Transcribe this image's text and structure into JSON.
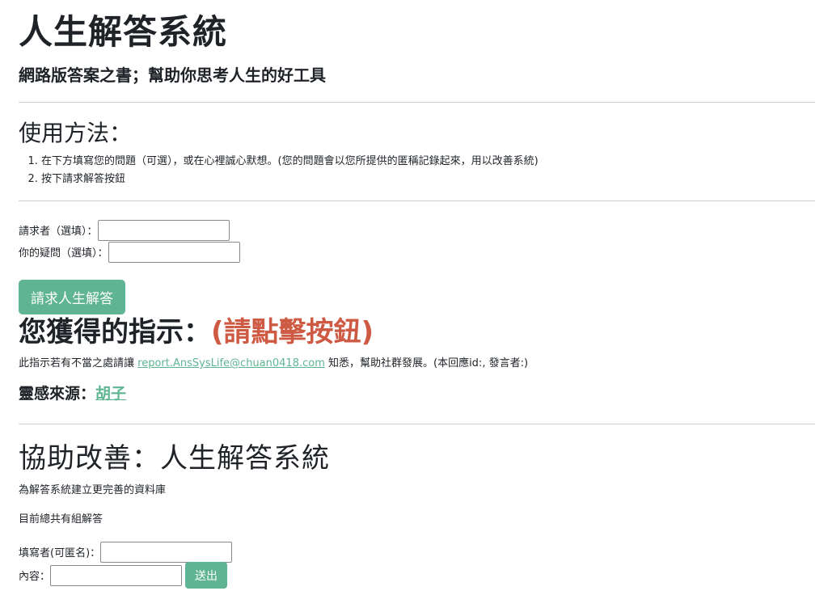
{
  "header": {
    "title": "人生解答系統",
    "subtitle": "網路版答案之書；幫助你思考人生的好工具"
  },
  "usage": {
    "title": "使用方法：",
    "steps": [
      "在下方填寫您的問題（可選），或在心裡誠心默想。(您的問題會以您所提供的匿稱記錄起來，用以改善系統)",
      "按下請求解答按鈕"
    ]
  },
  "request_form": {
    "requester_label": "請求者（選填）：",
    "requester_value": "",
    "question_label": "你的疑問（選填）：",
    "question_value": "",
    "button_label": "請求人生解答"
  },
  "answer": {
    "heading": "您獲得的指示：",
    "text": "(請點擊按鈕)",
    "report_prefix": "此指示若有不當之處請讓",
    "report_email": "report.AnsSysLife@chuan0418.com",
    "report_suffix": "知悉，幫助社群發展。(本回應id:, 發言者:)",
    "source_label": "靈感來源：",
    "source_name": "胡子"
  },
  "improve": {
    "title": "協助改善：人生解答系統",
    "description": "為解答系統建立更完善的資料庫",
    "total_text": "目前總共有組解答",
    "author_label": "填寫者(可匿名)：",
    "author_value": "",
    "content_label": "內容：",
    "content_value": "",
    "submit_label": "送出"
  },
  "colors": {
    "accent": "#5fb593",
    "answer_red": "#cf5a43"
  }
}
